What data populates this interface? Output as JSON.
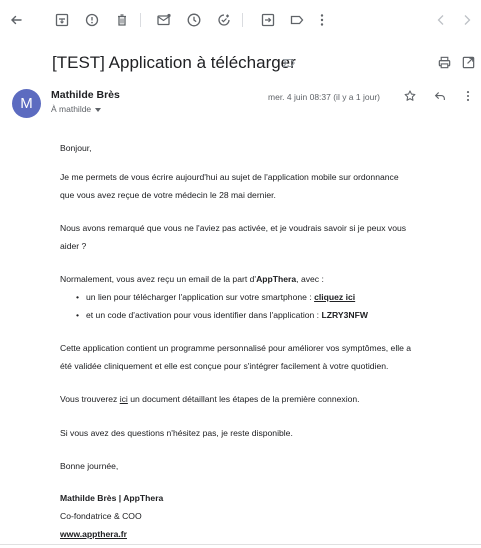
{
  "toolbar": {
    "icons": [
      "back-arrow-icon",
      "archive-icon",
      "report-spam-icon",
      "delete-icon",
      "mark-unread-icon",
      "snooze-icon",
      "add-to-tasks-icon",
      "move-to-icon",
      "labels-icon",
      "more-vert-icon",
      "newer-icon",
      "older-icon"
    ]
  },
  "email": {
    "subject": "[TEST] Application à télécharger",
    "sender_initial": "M",
    "sender_name": "Mathilde Brès",
    "to_line": "À mathilde",
    "date": "mer. 4 juin 08:37 (il y a 1 jour)"
  },
  "body": {
    "greeting": "Bonjour,",
    "p1_line1": "Je me permets de vous écrire aujourd'hui au sujet de l'application mobile sur ordonnance",
    "p1_line2": "que vous avez reçue de votre médecin le 28 mai dernier.",
    "p2_line1": "Nous avons remarqué que vous ne l'aviez pas activée, et je voudrais savoir si je peux vous",
    "p2_line2": "aider ?",
    "p3_pre": "Normalement, vous avez reçu un email de la part d'",
    "p3_brand": "AppThera",
    "p3_post": ", avec :",
    "bullet1_text": "un lien pour télécharger l'application sur votre smartphone : ",
    "bullet1_link": "cliquez ici",
    "bullet2_text": "et un code d'activation pour vous identifier dans l'application : ",
    "bullet2_code": "LZRY3NFW",
    "p4_line1": "Cette application contient un programme personnalisé pour améliorer vos symptômes, elle a",
    "p4_line2": "été validée cliniquement et elle est conçue pour s'intégrer facilement à votre quotidien.",
    "p5_pre": "Vous trouverez ",
    "p5_link": "ici",
    "p5_post": " un document détaillant les étapes de la première connexion.",
    "p6": "Si vous avez des questions n'hésitez pas, je reste disponible.",
    "closing": "Bonne journée,",
    "sig_name": "Mathilde Brès | AppThera",
    "sig_title": "Co-fondatrice & COO",
    "sig_url": "www.appthera.fr"
  },
  "colors": {
    "avatar": "#5c6bc0",
    "text": "#202124",
    "muted": "#5f6368"
  }
}
